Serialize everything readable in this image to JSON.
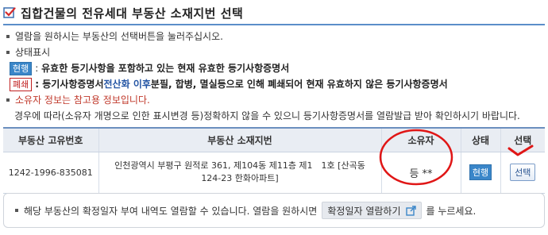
{
  "header": {
    "title": "집합건물의 전유세대 부동산 소재지번 선택",
    "icon": "check-box-icon",
    "accent_color": "#5b8ec9"
  },
  "guide": {
    "line1": "열람을 원하시는 부동산의 선택버튼을 눌러주십시오.",
    "line2": "상태표시",
    "active_tag": "현행",
    "active_desc_bold": "유효한 등기사항을 포함하고 있는 현재 유효한 등기사항증명서",
    "active_sep": ":",
    "closed_tag": "폐쇄",
    "closed_desc_pre": ": 등기사항증명서 ",
    "closed_desc_blue": "전산화 이후",
    "closed_desc_post": " 분필, 합병, 멸실등으로 인해 폐쇄되어 현재 유효하지 않은 등기사항증명서",
    "owner_note": "소유자 정보는 참고용 정보입니다.",
    "owner_note_detail": "경우에 따라(소유자 개명으로 인한 표시변경 등)정확하지 않을 수 있으니 등기사항증명서를 열람발급 받아 확인하시기 바랍니다."
  },
  "table": {
    "headers": {
      "id": "부동산 고유번호",
      "address": "부동산 소재지번",
      "owner": "소유자",
      "status": "상태",
      "select": "선택"
    },
    "rows": [
      {
        "id": "1242-1996-835081",
        "address": "인천광역시 부평구 원적로 361, 제104동 제11층 제1　1호 [산곡동 124-23 한화아파트]",
        "owner": "등 **",
        "status": "현행",
        "select_label": "선택"
      }
    ]
  },
  "notice": {
    "text_pre": "해당 부동산의 확정일자 부여 내역도 열람할 수 있습니다. 열람을 원하시면",
    "button_label": "확정일자 열람하기",
    "text_post": "를 누르세요."
  }
}
